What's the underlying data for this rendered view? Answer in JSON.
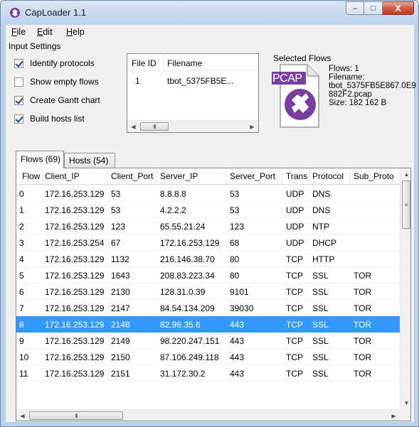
{
  "window": {
    "title": "CapLoader 1.1",
    "minimize_glyph": "–",
    "maximize_glyph": "□",
    "close_glyph": "X"
  },
  "menu": [
    {
      "underline": "F",
      "rest": "ile"
    },
    {
      "underline": "E",
      "rest": "dit"
    },
    {
      "underline": "H",
      "rest": "elp"
    }
  ],
  "input_settings": {
    "title": "Input Settings",
    "options": [
      {
        "label": "Identify protocols",
        "checked": true
      },
      {
        "label": "Show empty flows",
        "checked": false
      },
      {
        "label": "Create Gantt chart",
        "checked": true
      },
      {
        "label": "Build hosts list",
        "checked": true
      }
    ]
  },
  "file_list": {
    "columns": [
      "File ID",
      "Filename"
    ],
    "rows": [
      [
        "1",
        "tbot_5375FB5E..."
      ]
    ],
    "scroll_thumb": "III"
  },
  "selected_flows": {
    "title": "Selected Flows",
    "icon_label": "PCAP",
    "flows_line": "Flows: 1",
    "filename_label": "Filename:",
    "filename_line1": "tbot_5375FB5E867.0E9",
    "filename_line2": "882F2.pcap",
    "size_line": "Size: 182 162 B"
  },
  "tabs": [
    {
      "label": "Flows (69)",
      "active": true
    },
    {
      "label": "Hosts (54)",
      "active": false
    }
  ],
  "flows_table": {
    "columns": [
      "Flow",
      "Client_IP",
      "Client_Port",
      "Server_IP",
      "Server_Port",
      "Trans",
      "Protocol",
      "Sub_Proto"
    ],
    "selected_index": 8,
    "rows": [
      [
        "0",
        "172.16.253.129",
        "53",
        "8.8.8.8",
        "53",
        "UDP",
        "DNS",
        ""
      ],
      [
        "1",
        "172.16.253.129",
        "53",
        "4.2.2.2",
        "53",
        "UDP",
        "DNS",
        ""
      ],
      [
        "2",
        "172.16.253.129",
        "123",
        "65.55.21.24",
        "123",
        "UDP",
        "NTP",
        ""
      ],
      [
        "3",
        "172.16.253.254",
        "67",
        "172.16.253.129",
        "68",
        "UDP",
        "DHCP",
        ""
      ],
      [
        "4",
        "172.16.253.129",
        "1132",
        "216.146.38.70",
        "80",
        "TCP",
        "HTTP",
        ""
      ],
      [
        "5",
        "172.16.253.129",
        "1643",
        "208.83.223.34",
        "80",
        "TCP",
        "SSL",
        "TOR"
      ],
      [
        "6",
        "172.16.253.129",
        "2130",
        "128.31.0.39",
        "9101",
        "TCP",
        "SSL",
        "TOR"
      ],
      [
        "7",
        "172.16.253.129",
        "2147",
        "84.54.134.209",
        "39030",
        "TCP",
        "SSL",
        "TOR"
      ],
      [
        "8",
        "172.16.253.129",
        "2148",
        "82.96.35.6",
        "443",
        "TCP",
        "SSL",
        "TOR"
      ],
      [
        "9",
        "172.16.253.129",
        "2149",
        "98.220.247.151",
        "443",
        "TCP",
        "SSL",
        "TOR"
      ],
      [
        "10",
        "172.16.253.129",
        "2150",
        "87.106.249.118",
        "443",
        "TCP",
        "SSL",
        "TOR"
      ],
      [
        "11",
        "172.16.253.129",
        "2151",
        "31.172.30.2",
        "443",
        "TCP",
        "SSL",
        "TOR"
      ]
    ],
    "hscroll_thumb": "III",
    "vscroll_thumb": "≡"
  },
  "colors": {
    "selection": "#3399ff",
    "pcap_purple": "#7a3e9d",
    "close_red": "#c13b25"
  },
  "icons": [
    "caploader-app-icon",
    "pcap-file-icon",
    "scroll-left-icon",
    "scroll-right-icon",
    "scroll-up-icon",
    "scroll-down-icon"
  ]
}
